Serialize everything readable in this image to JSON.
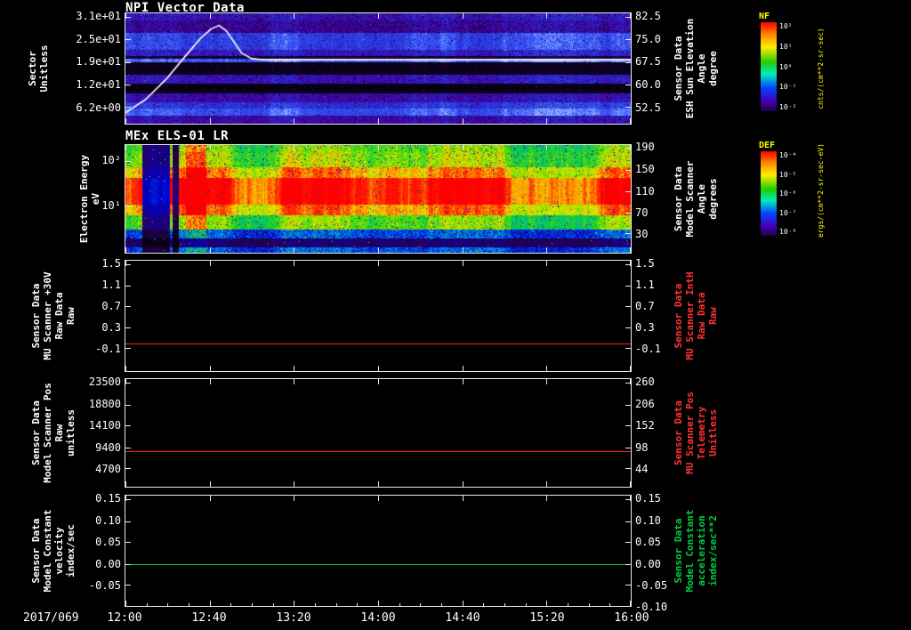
{
  "meta": {
    "background": "#000000",
    "foreground": "#ffffff",
    "red": "#ff3333",
    "green": "#00cc44",
    "yellow": "#ffff00"
  },
  "x_axis": {
    "date_label": "2017/069",
    "ticks": [
      "12:00",
      "12:40",
      "13:20",
      "14:00",
      "14:40",
      "15:20",
      "16:00"
    ]
  },
  "chart_data": [
    {
      "type": "heatmap",
      "title": "NPI Vector Data",
      "ylabel_lines": [
        "Sector",
        "Unitless"
      ],
      "y_ticks_left": [
        "3.1e+01",
        "2.5e+01",
        "1.9e+01",
        "1.2e+01",
        "6.2e+00"
      ],
      "right_label_lines": [
        "Sensor Data",
        "ESH Sun Elevation",
        "Angle",
        "degree"
      ],
      "y_ticks_right": [
        "82.5",
        "75.0",
        "67.5",
        "60.0",
        "52.5"
      ],
      "colorbar": {
        "title": "NF",
        "unit": "cnts/(cm**2-sr-sec)",
        "ticks": [
          "10²",
          "10¹",
          "10⁰",
          "10⁻¹",
          "10⁻²"
        ]
      },
      "palette": "npi",
      "bands": [
        [
          0,
          0.06,
          0.45,
          0.7
        ],
        [
          0.06,
          0.17,
          0.35,
          0.8
        ],
        [
          0.17,
          0.33,
          0.75,
          0.4
        ],
        [
          0.33,
          0.38,
          0.5,
          0.6
        ],
        [
          0.38,
          0.41,
          0.15,
          0.5
        ],
        [
          0.41,
          0.44,
          0.9,
          0.2
        ],
        [
          0.44,
          0.55,
          0.08,
          0.6
        ],
        [
          0.55,
          0.63,
          0.45,
          0.6
        ],
        [
          0.63,
          0.72,
          0.06,
          0.5
        ],
        [
          0.72,
          0.8,
          0.4,
          0.6
        ],
        [
          0.8,
          0.86,
          0.65,
          0.4
        ],
        [
          0.86,
          0.92,
          0.85,
          0.25
        ],
        [
          0.92,
          1,
          0.4,
          0.6
        ]
      ],
      "col_segments": [],
      "overlay_line": {
        "name": "ESH Sun Elevation Angle",
        "color": "#ffffff",
        "axis": "right",
        "peak_value": 82.5,
        "flat_value": 67.5,
        "points": [
          [
            0,
            0.9
          ],
          [
            0.04,
            0.78
          ],
          [
            0.08,
            0.6
          ],
          [
            0.12,
            0.38
          ],
          [
            0.15,
            0.22
          ],
          [
            0.17,
            0.14
          ],
          [
            0.185,
            0.11
          ],
          [
            0.2,
            0.16
          ],
          [
            0.215,
            0.26
          ],
          [
            0.23,
            0.36
          ],
          [
            0.25,
            0.41
          ],
          [
            0.27,
            0.42
          ],
          [
            1,
            0.42
          ]
        ]
      }
    },
    {
      "type": "heatmap",
      "title": "MEx ELS-01 LR",
      "ylabel_lines": [
        "Electron Energy",
        "eV"
      ],
      "y_ticks_left": [
        "10²",
        "10¹"
      ],
      "right_label_lines": [
        "Sensor Data",
        "Model Scanner",
        "Angle",
        "degrees"
      ],
      "y_ticks_right": [
        "190",
        "150",
        "110",
        "70",
        "30"
      ],
      "colorbar": {
        "title": "DEF",
        "unit": "ergs/(cm**2-sr-sec-eV)",
        "ticks": [
          "10⁻⁴",
          "10⁻⁵",
          "10⁻⁶",
          "10⁻⁷",
          "10⁻⁸"
        ]
      },
      "palette": "rainbow",
      "bands": [
        [
          0,
          0.06,
          0.58,
          0.35
        ],
        [
          0.06,
          0.2,
          0.62,
          0.35
        ],
        [
          0.2,
          0.3,
          0.78,
          0.25
        ],
        [
          0.3,
          0.55,
          0.96,
          0.12
        ],
        [
          0.55,
          0.65,
          0.8,
          0.2
        ],
        [
          0.65,
          0.78,
          0.58,
          0.3
        ],
        [
          0.78,
          0.86,
          0.3,
          0.6
        ],
        [
          0.86,
          0.95,
          0.12,
          0.7
        ],
        [
          0.95,
          1,
          0.3,
          0.5
        ]
      ],
      "col_segments": [
        [
          0.035,
          0.088,
          0.22
        ],
        [
          0.094,
          0.104,
          0.12
        ],
        [
          0.12,
          0.16,
          1.3
        ],
        [
          0.56,
          0.6,
          0.88
        ]
      ],
      "overlay_line": null
    },
    {
      "type": "line",
      "ylabel_lines": [
        "Sensor Data",
        "MU Scanner +30V",
        "Raw Data",
        "Raw"
      ],
      "y_ticks_left": [
        "1.5",
        "1.1",
        "0.7",
        "0.3",
        "-0.1"
      ],
      "right_label_lines": [
        "Sensor Data",
        "MU Scanner IntH",
        "Raw Data",
        "Raw"
      ],
      "y_ticks_right": [
        "1.5",
        "1.1",
        "0.7",
        "0.3",
        "-0.1"
      ],
      "ylim": [
        -0.1,
        1.5
      ],
      "series": [
        {
          "name": "MU Scanner +30V Raw Data",
          "color": "#ff2222",
          "value": 0,
          "y_frac": 0.746
        }
      ]
    },
    {
      "type": "line",
      "ylabel_lines": [
        "Sensor Data",
        "Model Scanner Pos",
        "Raw",
        "unitless"
      ],
      "y_ticks_left": [
        "23500",
        "18800",
        "14100",
        "9400",
        "4700"
      ],
      "right_label_lines": [
        "Sensor Data",
        "MU Scanner Pos",
        "Telemetry",
        "Unitless"
      ],
      "y_ticks_right": [
        "260",
        "206",
        "152",
        "98",
        "44"
      ],
      "ylim": [
        4700,
        23500
      ],
      "series": [
        {
          "name": "Model Scanner Pos Raw",
          "color": "#ff2222",
          "value": 8800,
          "value_right_scale": 92,
          "y_frac": 0.667
        }
      ]
    },
    {
      "type": "line",
      "ylabel_lines": [
        "Sensor Data",
        "Model Constant",
        "velocity",
        "index/sec"
      ],
      "y_ticks_left": [
        "0.15",
        "0.10",
        "0.05",
        "0.00",
        "-0.05"
      ],
      "right_label_lines": [
        "Sensor Data",
        "Model Constant",
        "acceleration",
        "index/sec**2"
      ],
      "y_ticks_right": [
        "0.15",
        "0.10",
        "0.05",
        "0.00",
        "-0.05",
        "-0.10"
      ],
      "ylim": [
        -0.1,
        0.15
      ],
      "series": [
        {
          "name": "Model Constant velocity",
          "color": "#00cc44",
          "value": 0,
          "y_frac": 0.619
        }
      ]
    }
  ]
}
